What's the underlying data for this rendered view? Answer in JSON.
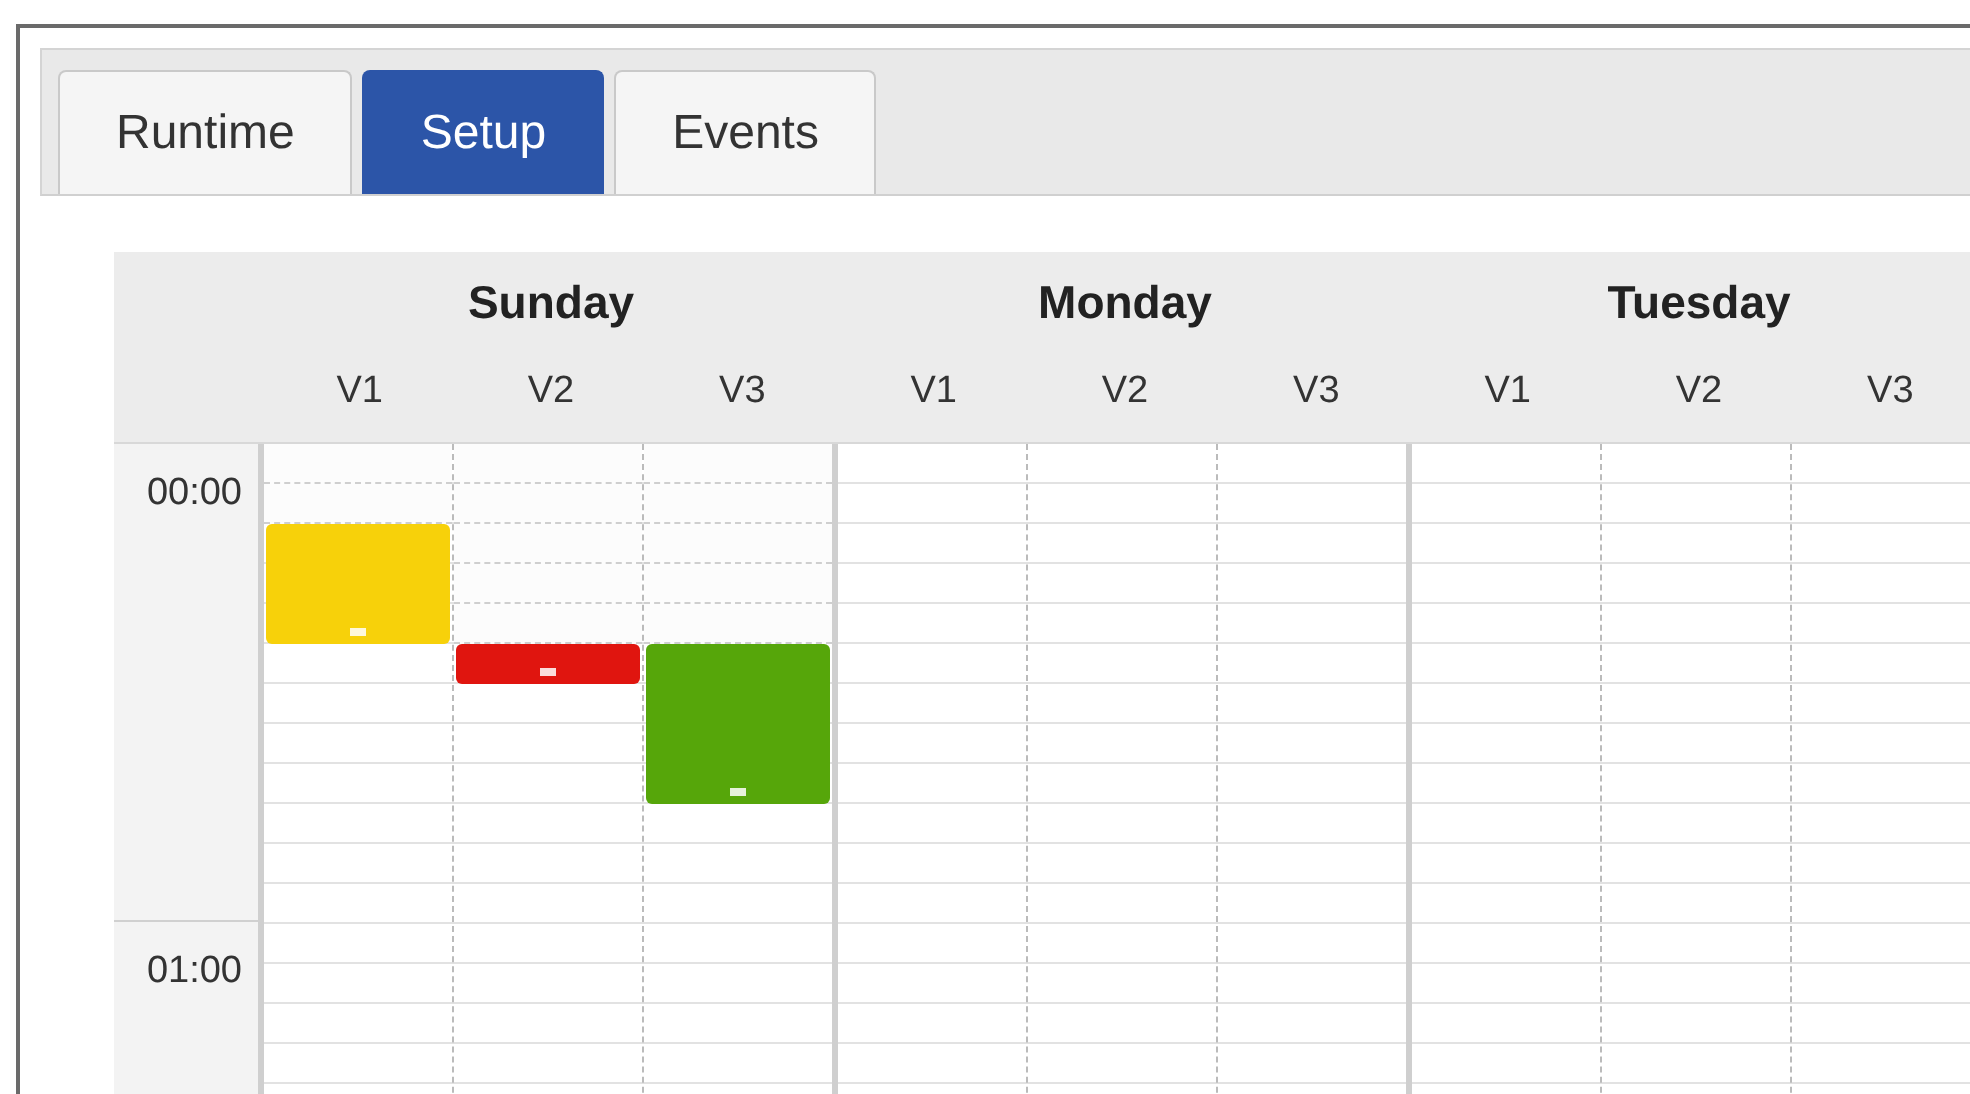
{
  "tabs": [
    {
      "label": "Runtime",
      "selected": false
    },
    {
      "label": "Setup",
      "selected": true
    },
    {
      "label": "Events",
      "selected": false
    }
  ],
  "schedule": {
    "hours": [
      "00:00",
      "01:00"
    ],
    "days": [
      {
        "name": "Sunday",
        "channels": [
          {
            "label": "V1",
            "color": "#f7d10a",
            "slots": [
              {
                "booked": false
              },
              {
                "booked": false
              },
              {
                "booked": true
              },
              {
                "booked": true
              },
              {
                "booked": true
              }
            ]
          },
          {
            "label": "V2",
            "color": "#e0150f",
            "slots": [
              {
                "booked": false
              },
              {
                "booked": false
              },
              {
                "booked": false
              },
              {
                "booked": false
              },
              {
                "booked": false
              },
              {
                "booked": true
              }
            ]
          },
          {
            "label": "V3",
            "color": "#56a60a",
            "slots": [
              {
                "booked": false
              },
              {
                "booked": false
              },
              {
                "booked": false
              },
              {
                "booked": false
              },
              {
                "booked": false
              },
              {
                "booked": true
              },
              {
                "booked": true
              },
              {
                "booked": true
              },
              {
                "booked": true
              }
            ]
          }
        ]
      },
      {
        "name": "Monday",
        "channels": [
          {
            "label": "V1"
          },
          {
            "label": "V2"
          },
          {
            "label": "V3"
          }
        ]
      },
      {
        "name": "Tuesday",
        "channels": [
          {
            "label": "V1"
          },
          {
            "label": "V2"
          },
          {
            "label": "V3"
          }
        ]
      }
    ]
  }
}
